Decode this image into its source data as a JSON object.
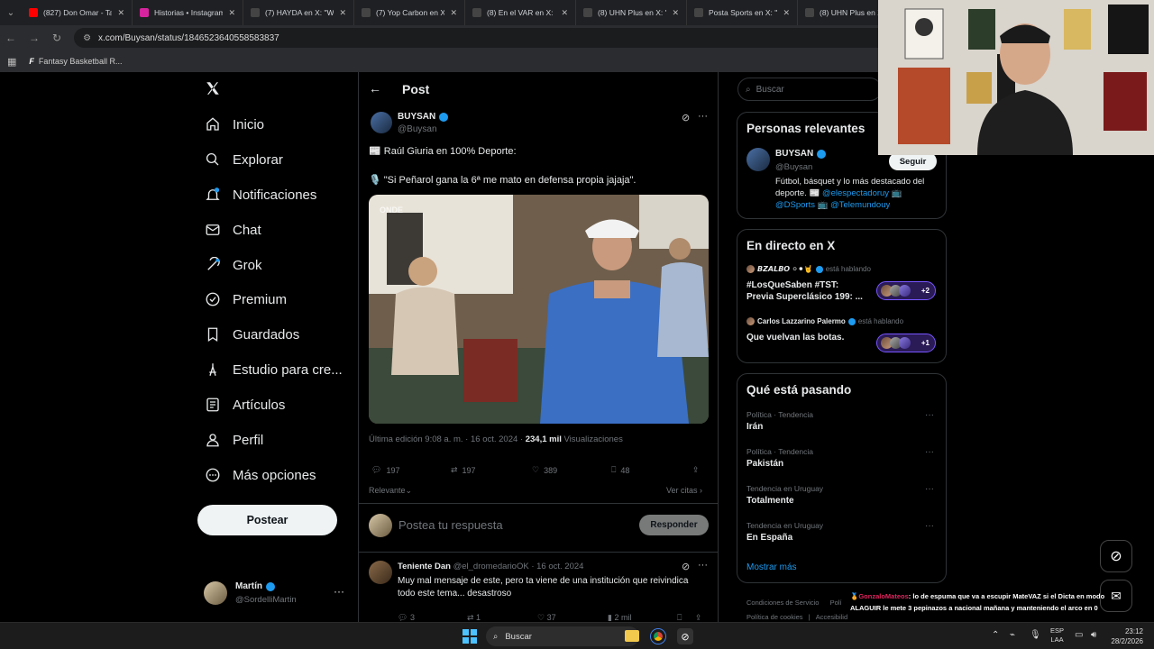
{
  "browser": {
    "tabs": [
      {
        "title": "(827) Don Omar - Tal",
        "color": "#ff0000"
      },
      {
        "title": "Historias • Instagram",
        "color": "#d6249f"
      },
      {
        "title": "(7) HAYDA en X: \"Wa",
        "color": "#444444"
      },
      {
        "title": "(7) Yop Carbon en X:",
        "color": "#444444"
      },
      {
        "title": "(8) En el VAR en X: \"",
        "color": "#444444"
      },
      {
        "title": "(8) UHN Plus en X: \"",
        "color": "#444444"
      },
      {
        "title": "Posta Sports en X: \"",
        "color": "#444444"
      },
      {
        "title": "(8) UHN Plus en X:",
        "color": "#444444"
      }
    ],
    "url": "x.com/Buysan/status/1846523640558583837",
    "bookmark": "Fantasy Basketball R..."
  },
  "nav": {
    "items": [
      {
        "label": "Inicio",
        "icon": "home-icon"
      },
      {
        "label": "Explorar",
        "icon": "search-icon"
      },
      {
        "label": "Notificaciones",
        "icon": "bell-icon"
      },
      {
        "label": "Chat",
        "icon": "mail-icon"
      },
      {
        "label": "Grok",
        "icon": "grok-icon"
      },
      {
        "label": "Premium",
        "icon": "verified-icon"
      },
      {
        "label": "Guardados",
        "icon": "bookmark-icon"
      },
      {
        "label": "Estudio para cre...",
        "icon": "studio-icon"
      },
      {
        "label": "Artículos",
        "icon": "articles-icon"
      },
      {
        "label": "Perfil",
        "icon": "profile-icon"
      },
      {
        "label": "Más opciones",
        "icon": "more-icon"
      }
    ],
    "post_button": "Postear",
    "account": {
      "name": "Martín",
      "handle": "@SordelliMartin"
    }
  },
  "header": {
    "title": "Post"
  },
  "tweet": {
    "author": "BUYSAN",
    "handle": "@Buysan",
    "line1": "📰 Raúl Giuria en 100% Deporte:",
    "line2": "🎙️ \"Si Peñarol gana la 6ª me mato en defensa propia jajaja\".",
    "media_watermark": "ONDE",
    "edited": "Última edición 9:08 a. m. · 16 oct. 2024 · ",
    "views_count": "234,1 mil",
    "views_label": " Visualizaciones",
    "replies": "197",
    "retweets": "197",
    "likes": "389",
    "bookmarks": "48",
    "sort": "Relevante",
    "quotes": "Ver citas"
  },
  "reply_box": {
    "placeholder": "Postea tu respuesta",
    "button": "Responder"
  },
  "reply": {
    "name": "Teniente Dan",
    "handle": "@el_dromedarioOK",
    "date": "· 16 oct. 2024",
    "text": "Muy mal mensaje de este, pero ta viene de una institución que reivindica todo este tema... desastroso",
    "replies": "3",
    "retweets": "1",
    "likes": "37",
    "views": "2 mil"
  },
  "search": {
    "placeholder": "Buscar"
  },
  "relevant": {
    "title": "Personas relevantes",
    "name": "BUYSAN",
    "handle": "@Buysan",
    "follow": "Seguir",
    "bio_plain": "Fútbol, básquet y lo más destacado del deporte. 📰 ",
    "bio_link1": "@elespectadoruy",
    "bio_emoji": " 📺",
    "bio_link2": "@DSports",
    "bio_emoji2": " 📺 ",
    "bio_link3": "@Telemundouy"
  },
  "live": {
    "title": "En directo en X",
    "items": [
      {
        "host": "𝘽𝙕𝘼𝙇𝘽𝙊 ⚪⚫🤘",
        "status": "está hablando",
        "title": "#LosQueSaben #TST: Previa Superclásico 199: ...",
        "extra": "+2"
      },
      {
        "host": "Carlos Lazzarino Palermo",
        "status": "está hablando",
        "title": "Que vuelvan las botas.",
        "extra": "+1"
      }
    ]
  },
  "trends": {
    "title": "Qué está pasando",
    "items": [
      {
        "meta": "Política · Tendencia",
        "name": "Irán"
      },
      {
        "meta": "Política · Tendencia",
        "name": "Pakistán"
      },
      {
        "meta": "Tendencia en Uruguay",
        "name": "Totalmente"
      },
      {
        "meta": "Tendencia en Uruguay",
        "name": "En España"
      }
    ],
    "more": "Mostrar más"
  },
  "footer": {
    "terms": "Condiciones de Servicio",
    "privacy": "Polí",
    "cookies": "Política de cookies",
    "access": "Accesibilid"
  },
  "chat_overlay": {
    "user": "GonzaloMateos",
    "line1": ": lo de espuma que va a escupir MateVAZ si el Dicta en modo",
    "line2": "ALAGUIR le mete 3 pepinazos a nacional mañana y manteniendo el arco en 0"
  },
  "taskbar": {
    "search": "Buscar",
    "lang1": "ESP",
    "lang2": "LAA",
    "time": "23:12",
    "date": "28/2/2026"
  }
}
